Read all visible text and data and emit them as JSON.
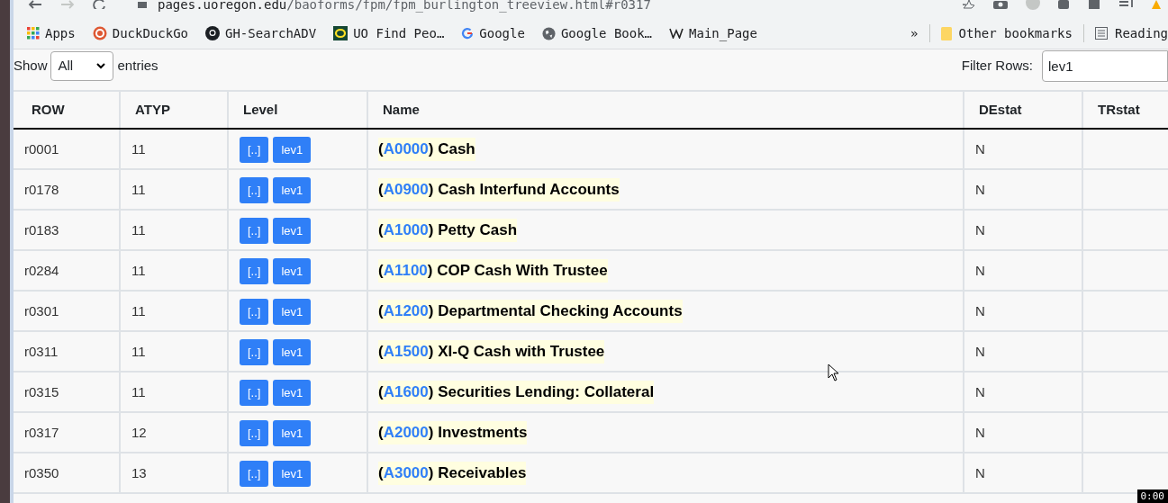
{
  "browser": {
    "back_enabled": true,
    "forward_enabled": false,
    "url_host": "pages.uoregon.edu",
    "url_path": "/baoforms/fpm/fpm_burlington_treeview.html#r0317",
    "bookmarks": [
      {
        "label": "Apps",
        "kind": "apps"
      },
      {
        "label": "DuckDuckGo",
        "kind": "duck"
      },
      {
        "label": "GH-SearchADV",
        "kind": "github"
      },
      {
        "label": "UO Find Peo…",
        "kind": "uo"
      },
      {
        "label": "Google",
        "kind": "google"
      },
      {
        "label": "Google Book…",
        "kind": "globe"
      },
      {
        "label": "Main_Page",
        "kind": "wiki"
      }
    ],
    "more": "»",
    "other_bookmarks": "Other bookmarks",
    "reading_list": "Reading"
  },
  "controls": {
    "show_label": "Show",
    "show_value": "All",
    "entries_label": "entries",
    "filter_label": "Filter Rows:",
    "filter_value": "lev1"
  },
  "table": {
    "columns": [
      "ROW",
      "ATYP",
      "Level",
      "Name",
      "DEstat",
      "TRstat"
    ],
    "rows": [
      {
        "row": "r0001",
        "atyp": "11",
        "buttons": [
          "[..]",
          "lev1"
        ],
        "name": {
          "before": "(",
          "code": "A0000",
          "after": ") Cash"
        },
        "destat": "N"
      },
      {
        "row": "r0178",
        "atyp": "11",
        "buttons": [
          "[..]",
          "lev1"
        ],
        "name": {
          "before": "(",
          "code": "A0900",
          "after": ") Cash Interfund Accounts"
        },
        "destat": "N"
      },
      {
        "row": "r0183",
        "atyp": "11",
        "buttons": [
          "[..]",
          "lev1"
        ],
        "name": {
          "before": "(",
          "code": "A1000",
          "after": ") Petty Cash"
        },
        "destat": "N"
      },
      {
        "row": "r0284",
        "atyp": "11",
        "buttons": [
          "[..]",
          "lev1"
        ],
        "name": {
          "before": "(",
          "code": "A1100",
          "after": ") COP Cash With Trustee"
        },
        "destat": "N"
      },
      {
        "row": "r0301",
        "atyp": "11",
        "buttons": [
          "[..]",
          "lev1"
        ],
        "name": {
          "before": "(",
          "code": "A1200",
          "after": ") Departmental Checking Accounts"
        },
        "destat": "N"
      },
      {
        "row": "r0311",
        "atyp": "11",
        "buttons": [
          "[..]",
          "lev1"
        ],
        "name": {
          "before": "(",
          "code": "A1500",
          "after": ") XI-Q Cash with Trustee"
        },
        "destat": "N"
      },
      {
        "row": "r0315",
        "atyp": "11",
        "buttons": [
          "[..]",
          "lev1"
        ],
        "name": {
          "before": "(",
          "code": "A1600",
          "after": ") Securities Lending: Collateral"
        },
        "destat": "N"
      },
      {
        "row": "r0317",
        "atyp": "12",
        "buttons": [
          "[..]",
          "lev1"
        ],
        "name": {
          "before": "(",
          "code": "A2000",
          "after": ") Investments"
        },
        "destat": "N"
      },
      {
        "row": "r0350",
        "atyp": "13",
        "buttons": [
          "[..]",
          "lev1"
        ],
        "name": {
          "before": "(",
          "code": "A3000",
          "after": ") Receivables"
        },
        "destat": "N"
      }
    ]
  },
  "recorder_timer": "0:00"
}
